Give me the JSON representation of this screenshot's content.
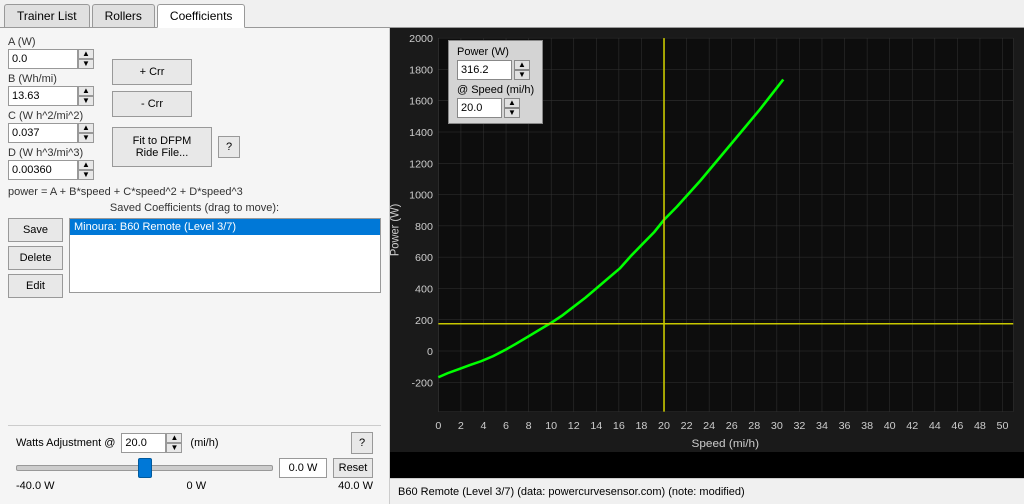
{
  "tabs": [
    {
      "id": "trainer-list",
      "label": "Trainer List"
    },
    {
      "id": "rollers",
      "label": "Rollers"
    },
    {
      "id": "coefficients",
      "label": "Coefficients",
      "active": true
    }
  ],
  "coefficients": {
    "a_label": "A (W)",
    "a_value": "0.0",
    "b_label": "B (Wh/mi)",
    "b_value": "13.63",
    "c_label": "C (W h^2/mi^2)",
    "c_value": "0.037",
    "d_label": "D (W h^3/mi^3)",
    "d_value": "0.00360",
    "add_crr": "+ Crr",
    "sub_crr": "- Crr",
    "fit_btn": "Fit to DFPM\nRide File...",
    "fit_btn_line1": "Fit to DFPM",
    "fit_btn_line2": "Ride File...",
    "help_label": "?",
    "formula": "power = A + B*speed + C*speed^2 + D*speed^3",
    "saved_label": "Saved Coefficients (drag to move):",
    "save_btn": "Save",
    "delete_btn": "Delete",
    "edit_btn": "Edit",
    "saved_items": [
      "Minoura: B60 Remote (Level 3/7)"
    ]
  },
  "watts": {
    "label": "Watts Adjustment @",
    "value": "20.0",
    "unit": "(mi/h)",
    "help": "?",
    "min_label": "-40.0 W",
    "zero_label": "0 W",
    "max_label": "40.0 W",
    "display": "0.0 W",
    "reset_btn": "Reset"
  },
  "chart": {
    "power_label": "Power (W)",
    "power_value": "316.2",
    "speed_label": "@ Speed (mi/h)",
    "speed_value": "20.0",
    "y_labels": [
      "2000",
      "1800",
      "1600",
      "1400",
      "1200",
      "1000",
      "800",
      "600",
      "400",
      "200",
      "0",
      "-200"
    ],
    "x_labels": [
      "0",
      "2",
      "4",
      "6",
      "8",
      "10",
      "12",
      "14",
      "16",
      "18",
      "20",
      "22",
      "24",
      "26",
      "28",
      "30",
      "32",
      "34",
      "36",
      "38",
      "40",
      "42",
      "44",
      "46",
      "48",
      "50"
    ],
    "y_axis_title": "Power (W)",
    "x_axis_title": "Speed (mi/h)"
  },
  "status": {
    "text": "B60 Remote (Level 3/7) (data: powercurvesensor.com) (note: modified)"
  }
}
